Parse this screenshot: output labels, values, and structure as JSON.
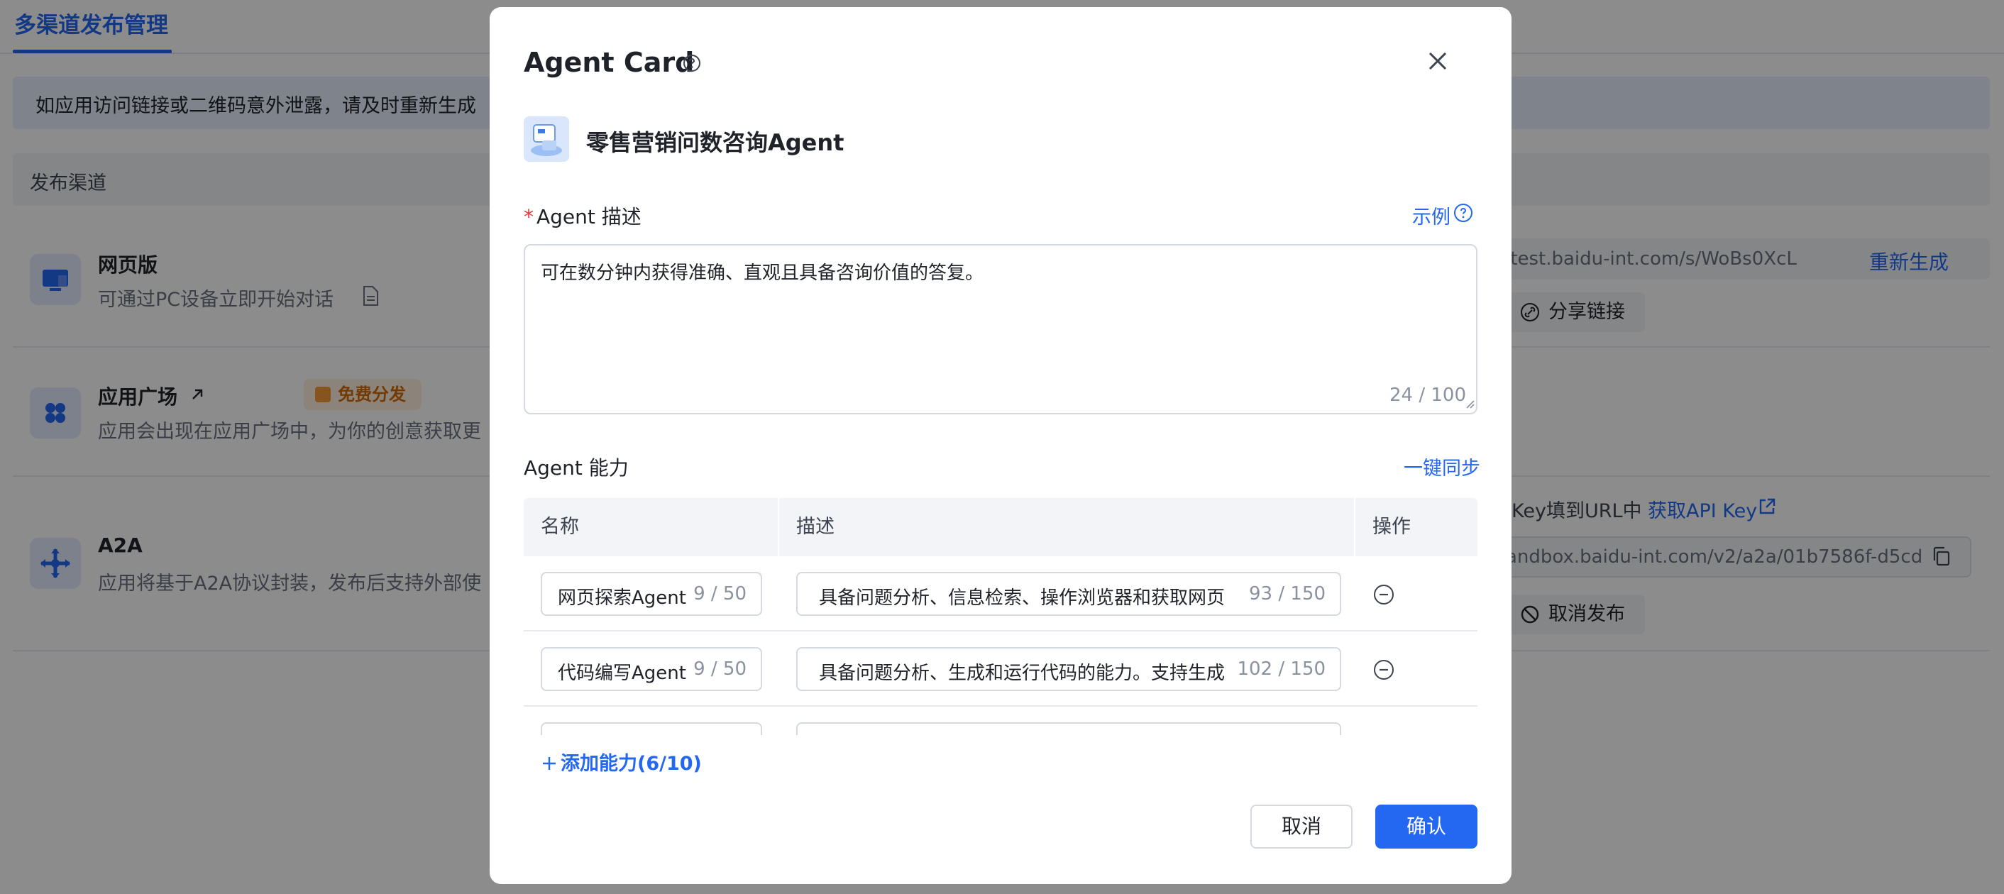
{
  "page": {
    "tab_active": "多渠道发布管理",
    "notice": "如应用访问链接或二维码意外泄露，请及时重新生成",
    "channels_header": "发布渠道",
    "channels": [
      {
        "title": "网页版",
        "desc": "可通过PC设备立即开始对话"
      },
      {
        "title": "应用广场",
        "badge": "免费分发",
        "desc": "应用会出现在应用广场中，为你的创意获取更"
      },
      {
        "title": "A2A",
        "desc": "应用将基于A2A协议封装，发布后支持外部使"
      }
    ],
    "web_link_url": ".test.baidu-int.com/s/WoBs0XcL",
    "regenerate_label": "重新生成",
    "share_link_label": "分享链接",
    "a2a_key_hint": "Key填到URL中",
    "get_api_key_label": "获取API Key",
    "a2a_url": "andbox.baidu-int.com/v2/a2a/01b7586f-d5cd",
    "unpublish_label": "取消发布"
  },
  "modal": {
    "title": "Agent Card",
    "agent_name": "零售营销问数咨询Agent",
    "desc_label": "Agent 描述",
    "required_mark": "*",
    "example_label": "示例",
    "desc_value": "可在数分钟内获得准确、直观且具备咨询价值的答复。",
    "desc_count": "24 / 100",
    "capability_label": "Agent 能力",
    "sync_label": "一键同步",
    "columns": {
      "name": "名称",
      "desc": "描述",
      "action": "操作"
    },
    "rows": [
      {
        "name": "网页探索Agent",
        "name_count": "9 / 50",
        "desc": "具备问题分析、信息检索、操作浏览器和获取网页",
        "desc_count": "93 / 150"
      },
      {
        "name": "代码编写Agent",
        "name_count": "9 / 50",
        "desc": "具备问题分析、生成和运行代码的能力。支持生成",
        "desc_count": "102 / 150"
      }
    ],
    "add_capability_label": "添加能力(6/10)",
    "cancel_label": "取消",
    "confirm_label": "确认"
  },
  "colors": {
    "accent": "#2468f2",
    "required": "#e53935",
    "badge": "#d46b08"
  }
}
